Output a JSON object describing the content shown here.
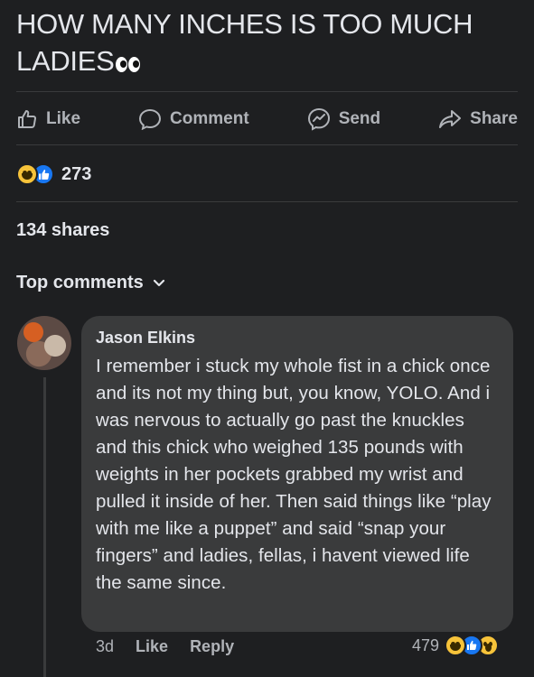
{
  "post": {
    "text": "HOW MANY INCHES IS TOO MUCH LADIES",
    "emoji_icon": "eyes-icon"
  },
  "actions": {
    "like": "Like",
    "comment": "Comment",
    "send": "Send",
    "share": "Share"
  },
  "reactions": {
    "count": "273",
    "icons": [
      "haha-icon",
      "like-icon"
    ]
  },
  "shares": "134 shares",
  "top_comments_label": "Top comments",
  "comment": {
    "author": "Jason Elkins",
    "body": "I remember i stuck my whole fist in a chick once and its not my thing but, you know, YOLO. And i was nervous to actually go past the knuckles and this chick who weighed 135 pounds with weights in her pockets grabbed my wrist and pulled it inside of her. Then said things like “play with me like a puppet” and said “snap your fingers” and ladies, fellas, i havent viewed life the same since.",
    "time": "3d",
    "like": "Like",
    "reply": "Reply",
    "reaction_count": "479",
    "reaction_icons": [
      "haha-icon",
      "like-icon",
      "wow-icon"
    ]
  },
  "colors": {
    "background": "#1e1f21",
    "bubble": "#3a3b3c",
    "text": "#e4e6eb",
    "secondary_text": "#b0b3b8",
    "like_blue": "#1877f2",
    "emoji_yellow": "#f7c33a"
  }
}
